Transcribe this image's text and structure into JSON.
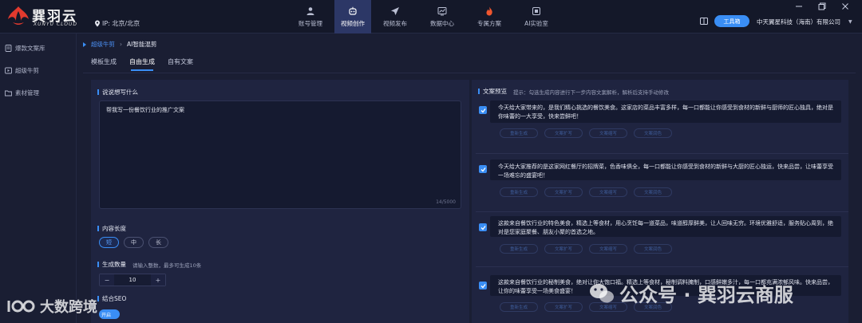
{
  "app": {
    "logo_cn": "巽羽云",
    "logo_en": "XUNYU CLOUD",
    "ip_label": "IP: 北京/北京"
  },
  "nav": [
    {
      "label": "账号管理",
      "icon": "person-icon"
    },
    {
      "label": "视频创作",
      "icon": "video-ai-icon"
    },
    {
      "label": "视频发布",
      "icon": "send-icon"
    },
    {
      "label": "数据中心",
      "icon": "chart-icon"
    },
    {
      "label": "专属方案",
      "icon": "flame-icon"
    },
    {
      "label": "AI实验室",
      "icon": "lab-icon"
    }
  ],
  "header": {
    "workbench_label": "工具箱",
    "company": "中天翼星科技（海南）有限公司"
  },
  "sidebar": [
    {
      "label": "爆款文案库"
    },
    {
      "label": "超级牛剪"
    },
    {
      "label": "素材管理"
    }
  ],
  "breadcrumb": {
    "parent": "超级牛剪",
    "sep": "›",
    "current": "AI智能混剪"
  },
  "tabs": [
    "模板生成",
    "自由生成",
    "自有文案"
  ],
  "form": {
    "prompt_label": "说说想写什么",
    "prompt_value": "帮我写一份餐饮行业的推广文案",
    "prompt_counter": "14/5000",
    "length_label": "内容长度",
    "length_options": [
      "短",
      "中",
      "长"
    ],
    "count_label": "生成数量",
    "count_hint": "请输入整数，最多可生成10条",
    "count_value": "10",
    "minus": "−",
    "plus": "+",
    "seo_label": "结合SEO",
    "seo_toggle": "开启"
  },
  "preview": {
    "title": "文案预览",
    "hint": "提示：勾选生成内容进行下一步内容文案解析，解析后支持手动修改",
    "action_labels": [
      "重新生成",
      "文案扩写",
      "文案缩写",
      "文案润色"
    ],
    "items": [
      {
        "text": "今天给大家带来的，是我们精心挑选的餐饮美食。这家店的菜品丰富多样，每一口都能让你感受到食材的新鲜与厨师的匠心独具，绝对是你味蕾的一大享受，快来尝鲜吧！"
      },
      {
        "text": "今天给大家推荐的是这家网红餐厅的招牌菜，色香味俱全，每一口都能让你感受到食材的新鲜与大厨的匠心独运，快来品尝，让味蕾享受一场难忘的盛宴吧！"
      },
      {
        "text": "这款来自餐饮行业的特色美食，精选上等食材，用心烹饪每一道菜品，味道醇厚鲜美，让人回味无穷。环境优雅舒适，服务贴心周到，绝对是您家庭聚餐、朋友小聚的首选之地。"
      },
      {
        "text": "这款来自餐饮行业的秘制美食，绝对让你大饱口福。精选上等食材，秘制调料腌制，口感鲜嫩多汁，每一口都充满浓郁风味。快来品尝，让你的味蕾享受一场美食盛宴！"
      }
    ]
  },
  "watermarks": {
    "left": "大数跨境",
    "right": "公众号 · 巽羽云商服"
  },
  "colors": {
    "accent": "#3a8ef5",
    "bg": "#1a1e33",
    "panel": "#1f2440"
  }
}
